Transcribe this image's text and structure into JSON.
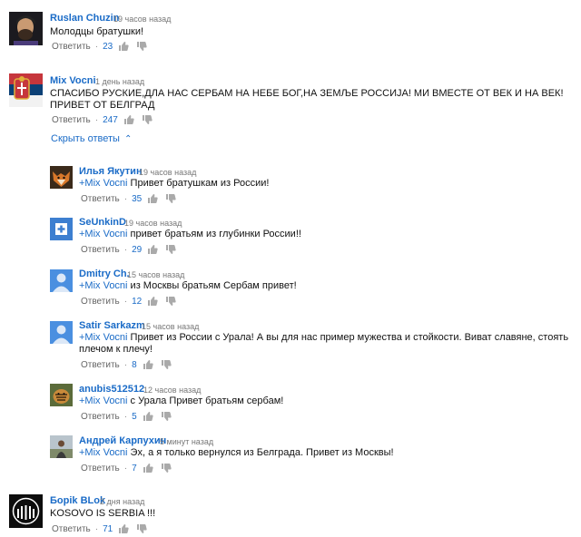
{
  "reply_label": "Ответить",
  "toggle_label": "Скрыть ответы",
  "comments": [
    {
      "author": "Ruslan Chuzin",
      "time": "19 часов назад",
      "text": "Молодцы братушки!",
      "likes": "23"
    },
    {
      "author": "Mix Vocni",
      "time": "1 день назад",
      "text": "СПАСИБО РУСКИЕ,ДЛА НАС СЕРБАМ НА НЕБЕ БОГ,НА ЗЕМЉЕ РОССИЈА! МИ ВМЕСТЕ ОТ ВЕК И НА ВЕК! ПРИВЕТ ОТ БЕЛГРАД",
      "likes": "247"
    },
    {
      "author": "Борik BLok",
      "time": "2 дня назад",
      "text": "KOSOVO IS SERBIA !!!",
      "likes": "71"
    }
  ],
  "replies": [
    {
      "author": "Илья Якутин",
      "time": "19 часов назад",
      "mention": "+Mix Vocni",
      "text": " Привет братушкам из России!",
      "likes": "35"
    },
    {
      "author": "SeUnkinD",
      "time": "19 часов назад",
      "mention": "+Mix Vocni",
      "text": " привет братьям из глубинки России!!",
      "likes": "29"
    },
    {
      "author": "Dmitry Ch.",
      "time": "15 часов назад",
      "mention": "+Mix Vocni",
      "text": " из Москвы братьям Сербам привет!",
      "likes": "12"
    },
    {
      "author": "Satir Sarkazm",
      "time": "15 часов назад",
      "mention": "+Mix Vocni",
      "text": " Привет из России с Урала! А вы для нас пример мужества и стойкости. Виват славяне, стоять плечом к плечу!",
      "likes": "8"
    },
    {
      "author": "anubis512512",
      "time": "12 часов назад",
      "mention": "+Mix Vocni",
      "text": " с Урала Привет братьям сербам!",
      "likes": "5"
    },
    {
      "author": "Андрей Карпухин",
      "time": "5 минут назад",
      "mention": "+Mix Vocni",
      "text": " Эх, а я только вернулся из Белграда. Привет из Москвы!",
      "likes": "7"
    }
  ],
  "colors": {
    "link": "#1a6bc7",
    "text": "#111111",
    "muted": "#777777"
  }
}
